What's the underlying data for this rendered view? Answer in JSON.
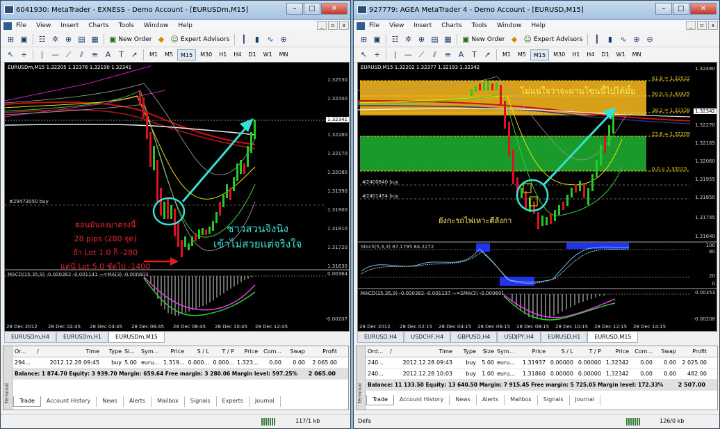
{
  "left": {
    "title": "6041930: MetaTrader - EXNESS - Demo Account - [EURUSDm,M15]",
    "menu": [
      "File",
      "View",
      "Insert",
      "Charts",
      "Tools",
      "Window",
      "Help"
    ],
    "new_order": "New Order",
    "expert_advisors": "Expert Advisors",
    "timeframes": [
      "M1",
      "M5",
      "M15",
      "M30",
      "H1",
      "H4",
      "D1",
      "W1",
      "MN"
    ],
    "active_timeframe": "M15",
    "chart": {
      "ohlc": "EURUSDm,M15  1.32205 1.32376 1.32190 1.32341",
      "prices": [
        "1.32530",
        "1.32440",
        "1.32260",
        "1.32170",
        "1.32080",
        "1.31990",
        "1.31900",
        "1.31810",
        "1.31720",
        "1.31630"
      ],
      "current_price": "1.32341",
      "order_label": "#29473050 buy",
      "annotation_red": [
        "ตอนมันลงมาตรงนี้",
        "28 pips (280 จุด)",
        "ถ้า Lot 1.0 ก็ -280",
        "แต่นี่ Lot 5.0 ซัดไป -1400"
      ],
      "annotation_cyan": [
        "ชาวสวนจิงนิง",
        "เข้าไม่สวยแต่จริงใจ"
      ],
      "macd_label": "MACD(15,35,9) -0.000382 -0.001141 ~=MA(3) -0.000603",
      "macd_prices": [
        "0.00364",
        "-0.00207"
      ],
      "times": [
        "28 Dec 2012",
        "28 Dec 02:45",
        "28 Dec 04:45",
        "28 Dec 06:45",
        "28 Dec 08:45",
        "28 Dec 10:45",
        "28 Dec 12:45"
      ]
    },
    "chart_tabs": [
      "EURUSDm,H4",
      "EURUSDm,H1",
      "EURUSDm,M15"
    ],
    "active_chart_tab": "EURUSDm,M15",
    "terminal": {
      "side_label": "Terminal",
      "columns": [
        "Or...",
        "/",
        "Time",
        "Type",
        "Si...",
        "Sym...",
        "Price",
        "S / L",
        "T / P",
        "Price",
        "Com...",
        "Swap",
        "Profit"
      ],
      "rows": [
        [
          "294...",
          "",
          "2012.12.28 09:45",
          "buy",
          "5.00",
          "euru...",
          "1.319...",
          "0.000...",
          "0.000...",
          "1.323...",
          "0.00",
          "0.00",
          "2 065.00"
        ]
      ],
      "balance": "Balance: 1 874.70  Equity: 3 939.70  Margin: 659.64  Free margin: 3 280.06  Margin level: 597.25%",
      "balance_profit": "2 065.00",
      "tabs": [
        "Trade",
        "Account History",
        "News",
        "Alerts",
        "Mailbox",
        "Signals",
        "Experts",
        "Journal"
      ]
    },
    "status_right": "117/1 kb"
  },
  "right": {
    "title": "927779: AGEA MetaTrader 4 - Demo Account - [EURUSD,M15]",
    "menu": [
      "File",
      "View",
      "Insert",
      "Charts",
      "Tools",
      "Window",
      "Help"
    ],
    "new_order": "New Order",
    "expert_advisors": "Expert Advisors",
    "timeframes": [
      "M1",
      "M5",
      "M15",
      "M30",
      "H1",
      "H4",
      "D1",
      "W1",
      "MN"
    ],
    "active_timeframe": "M15",
    "chart": {
      "ohlc": "EURUSD,M15  1.32202 1.32377 1.32193 1.32342",
      "prices": [
        "1.32480",
        "1.32270",
        "1.32165",
        "1.32060",
        "1.31955",
        "1.31850",
        "1.31745",
        "1.31640"
      ],
      "current_price": "1.32342",
      "fib": [
        "61.8 = 1.32522",
        "50.0 = 1.32425",
        "38.2 = 1.32328",
        "23.6 = 1.32209",
        "0.0 = 1.32015"
      ],
      "orders": [
        "#2400840 buy",
        "#2401454 buy"
      ],
      "annotation_top": "ไม่แน่ใจว่าจะผ่านโซนนี้ไปได้มั้ย",
      "annotation_bottom": "ยังกะรถไฟเหาะตีลังกา",
      "stoch_label": "Stoch(5,3,3) 87.1795 84.2272",
      "stoch_levels": [
        "100",
        "80",
        "20",
        "0"
      ],
      "macd_label": "MACD(15,35,9) -0.000382 -0.001137 ~=SMA(3) -0.000601",
      "macd_prices": [
        "0.00353",
        "-0.00208"
      ],
      "times": [
        "28 Dec 2012",
        "28 Dec 02:15",
        "28 Dec 04:15",
        "28 Dec 06:15",
        "28 Dec 08:15",
        "28 Dec 10:15",
        "28 Dec 12:15",
        "28 Dec 14:15"
      ]
    },
    "chart_tabs": [
      "EURUSD,H4",
      "USDCHF,H4",
      "GBPUSD,H4",
      "USDJPY,H4",
      "EURUSD,H1",
      "EURUSD,M15"
    ],
    "active_chart_tab": "EURUSD,M15",
    "terminal": {
      "side_label": "Terminal",
      "columns": [
        "Ord...",
        "/",
        "Time",
        "Type",
        "Size",
        "Sym...",
        "Price",
        "S / L",
        "T / P",
        "Price",
        "Com...",
        "Swap",
        "Profit"
      ],
      "rows": [
        [
          "240...",
          "",
          "2012.12.28 09:43",
          "buy",
          "5.00",
          "euru...",
          "1.31937",
          "0.00000",
          "0.00000",
          "1.32342",
          "0.00",
          "0.00",
          "2 025.00"
        ],
        [
          "240...",
          "",
          "2012.12.28 10:03",
          "buy",
          "1.00",
          "euru...",
          "1.31860",
          "0.00000",
          "0.00000",
          "1.32342",
          "0.00",
          "0.00",
          "482.00"
        ]
      ],
      "balance": "Balance: 11 133.50  Equity: 13 640.50  Margin: 7 915.45  Free margin: 5 725.05  Margin level: 172.33%",
      "balance_profit": "2 507.00",
      "tabs": [
        "Trade",
        "Account History",
        "News",
        "Alerts",
        "Mailbox",
        "Signals",
        "Journal"
      ]
    },
    "status_left": "Defa",
    "status_right": "126/0 kb"
  }
}
